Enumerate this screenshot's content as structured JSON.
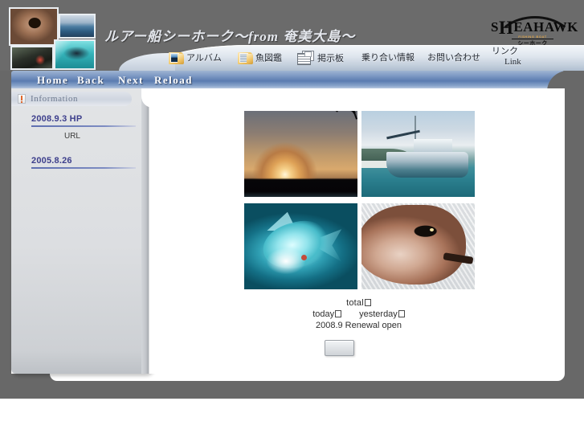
{
  "header": {
    "site_title": "ルアー船シーホーク～from 奄美大島～",
    "logo": {
      "wordmark_pre": "S",
      "wordmark": "EAHAWK",
      "tall_letters": "H",
      "sub_en": "FISHING BOAT",
      "sub_jp": "シーホーク"
    },
    "collage_alts": [
      "fish-head-photo",
      "sea-photo",
      "boat-deck-photo",
      "lure-photo"
    ]
  },
  "menu": {
    "items": [
      {
        "label": "アルバム",
        "icon": "folder-album-icon"
      },
      {
        "label": "魚図鑑",
        "icon": "folder-fish-guide-icon"
      },
      {
        "label": "掲示板",
        "icon": "newspaper-bbs-icon"
      },
      {
        "label": "乗り合い情報",
        "icon": ""
      },
      {
        "label": "お問い合わせ",
        "icon": ""
      },
      {
        "label": "リンク",
        "label2": "Link",
        "icon": ""
      }
    ]
  },
  "navbar": {
    "home": "Home",
    "back": "Back",
    "next": "Next",
    "reload": "Reload"
  },
  "sidebar": {
    "panel_title": "Information",
    "panel_icon": "exclamation-icon",
    "entries": [
      {
        "date": "2008.9.3  HP",
        "sub": "URL"
      },
      {
        "date": "2005.8.26",
        "sub": ""
      }
    ]
  },
  "main": {
    "photos": [
      {
        "name": "sunset-palm-photo"
      },
      {
        "name": "fishing-boat-photo"
      },
      {
        "name": "underwater-fish-photo"
      },
      {
        "name": "fish-head-closeup-photo"
      }
    ],
    "counter": {
      "total_label": "total",
      "today_label": "today",
      "yesterday_label": "yesterday",
      "renewal": "2008.9 Renewal open"
    },
    "button_label": ""
  },
  "colors": {
    "page_bg": "#686868",
    "navbar_blue": "#5b7cb0",
    "sidebar_gray": "#dcdee1",
    "date_purple": "#3d3f8c",
    "accent_orange": "#e0672c"
  }
}
